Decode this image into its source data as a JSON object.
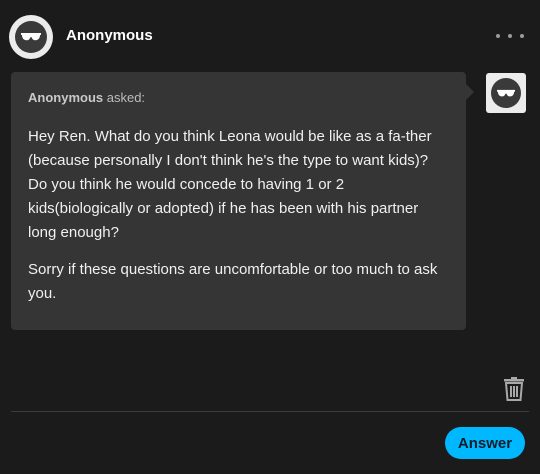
{
  "header": {
    "username": "Anonymous",
    "avatar_icon": "anonymous-sunglasses-icon",
    "more_icon": "more-horizontal-icon"
  },
  "ask": {
    "asker": "Anonymous",
    "asked_suffix": " asked:",
    "paragraphs": [
      "Hey Ren. What do you think Leona would be like as a fa-ther (because personally I don't think he's the type to want kids)? Do you think he would concede to having 1 or 2 kids(biologically or adopted) if he has been with his partner long enough?",
      "Sorry if these questions are uncomfortable or too much to ask you."
    ]
  },
  "actions": {
    "delete_icon": "trash-icon",
    "answer_label": "Answer"
  },
  "colors": {
    "background": "#1b1b1b",
    "bubble": "#353535",
    "accent": "#00b8ff"
  }
}
